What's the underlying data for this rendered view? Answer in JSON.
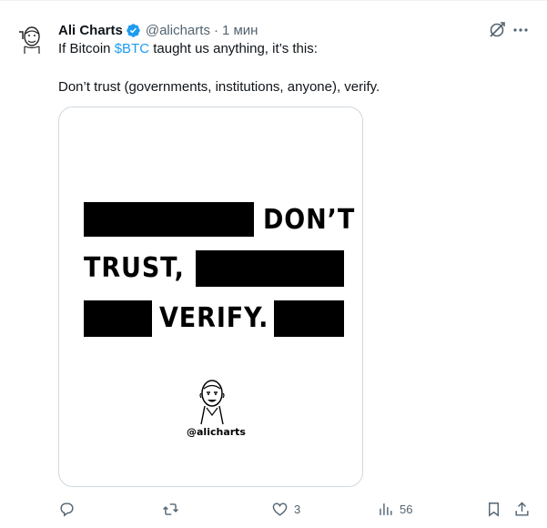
{
  "author": {
    "name": "Ali Charts",
    "handle": "@alicharts",
    "separator": "·",
    "time": "1 мин"
  },
  "tweet": {
    "line1_prefix": "If Bitcoin ",
    "line1_cashtag": "$BTC",
    "line1_suffix": " taught us anything, it’s this:",
    "line2": "Don’t trust (governments, institutions, anyone), verify."
  },
  "image": {
    "word_dont": "DON’T",
    "word_trust": "TRUST,",
    "word_verify": "VERIFY.",
    "signature": "@alicharts"
  },
  "actions": {
    "reply_count": "",
    "retweet_count": "",
    "like_count": "3",
    "views_count": "56"
  },
  "colors": {
    "accent": "#1d9bf0",
    "secondary_text": "#536471",
    "border": "#cfd9de"
  },
  "icons": [
    "avatar",
    "verified-badge-icon",
    "grok-icon",
    "more-icon",
    "reply-icon",
    "retweet-icon",
    "like-icon",
    "views-icon",
    "bookmark-icon",
    "share-icon"
  ]
}
